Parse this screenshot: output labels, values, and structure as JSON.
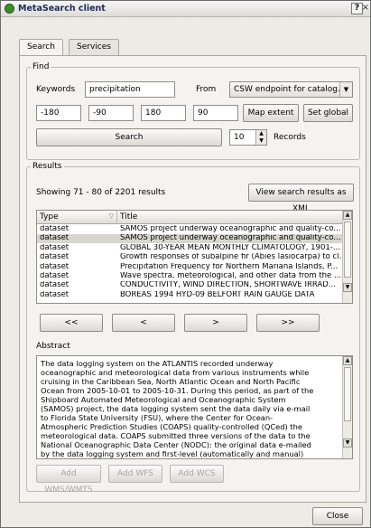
{
  "window": {
    "title": "MetaSearch client",
    "help_label": "?",
    "close_glyph": "×"
  },
  "tabs": [
    {
      "label": "Search"
    },
    {
      "label": "Services"
    }
  ],
  "find": {
    "group_label": "Find",
    "keywords_label": "Keywords",
    "keywords_value": "precipitation",
    "from_label": "From",
    "from_value": "CSW endpoint for catalog.d",
    "bbox": {
      "west": "-180",
      "south": "-90",
      "east": "180",
      "north": "90"
    },
    "map_extent_label": "Map extent",
    "set_global_label": "Set global",
    "search_label": "Search",
    "records_value": "10",
    "records_label": "Records"
  },
  "results": {
    "group_label": "Results",
    "showing_text": "Showing 71 - 80 of 2201 results",
    "view_xml_label": "View search results as XML",
    "columns": [
      "Type",
      "Title"
    ],
    "rows": [
      {
        "type": "dataset",
        "title": "SAMOS project underway oceanographic and quality-co..."
      },
      {
        "type": "dataset",
        "title": "SAMOS project underway oceanographic and quality-co..."
      },
      {
        "type": "dataset",
        "title": "GLOBAL 30-YEAR MEAN MONTHLY CLIMATOLOGY, 1901-..."
      },
      {
        "type": "dataset",
        "title": "Growth responses of subalpine fir (Abies lasiocarpa) to cl..."
      },
      {
        "type": "dataset",
        "title": "Precipitation Frequency for Northern Mariana Islands, P..."
      },
      {
        "type": "dataset",
        "title": "Wave spectra, meteorological, and other data from the ..."
      },
      {
        "type": "dataset",
        "title": "CONDUCTIVITY, WIND DIRECTION, SHORTWAVE IRRAD..."
      },
      {
        "type": "dataset",
        "title": "BOREAS 1994 HYD-09 BELFORT RAIN GAUGE DATA"
      }
    ],
    "selected_row": 1,
    "nav": {
      "first": "<<",
      "prev": "<",
      "next": ">",
      "last": ">>"
    }
  },
  "abstract": {
    "label": "Abstract",
    "text": "The data logging system on the ATLANTIS recorded underway oceanographic and meteorological data from various instruments while cruising in the Caribbean Sea, North Atlantic Ocean and North Pacific Ocean from 2005-10-01 to 2005-10-31. During this period, as part of the Shipboard Automated Meteorological and Oceanographic System (SAMOS) project, the data logging system sent the data daily via e-mail to Florida State University (FSU), where the Center for Ocean-Atmospheric Prediction Studies (COAPS) quality-controlled (QCed) the meteorological data. COAPS submitted three versions of the data to the National Oceanographic Data Center (NODC): the original data e-mailed by the data logging system and first-level (automatically and manual)"
  },
  "add_buttons": {
    "wms": "Add WMS/WMTS",
    "wfs": "Add WFS",
    "wcs": "Add WCS"
  },
  "close_label": "Close"
}
